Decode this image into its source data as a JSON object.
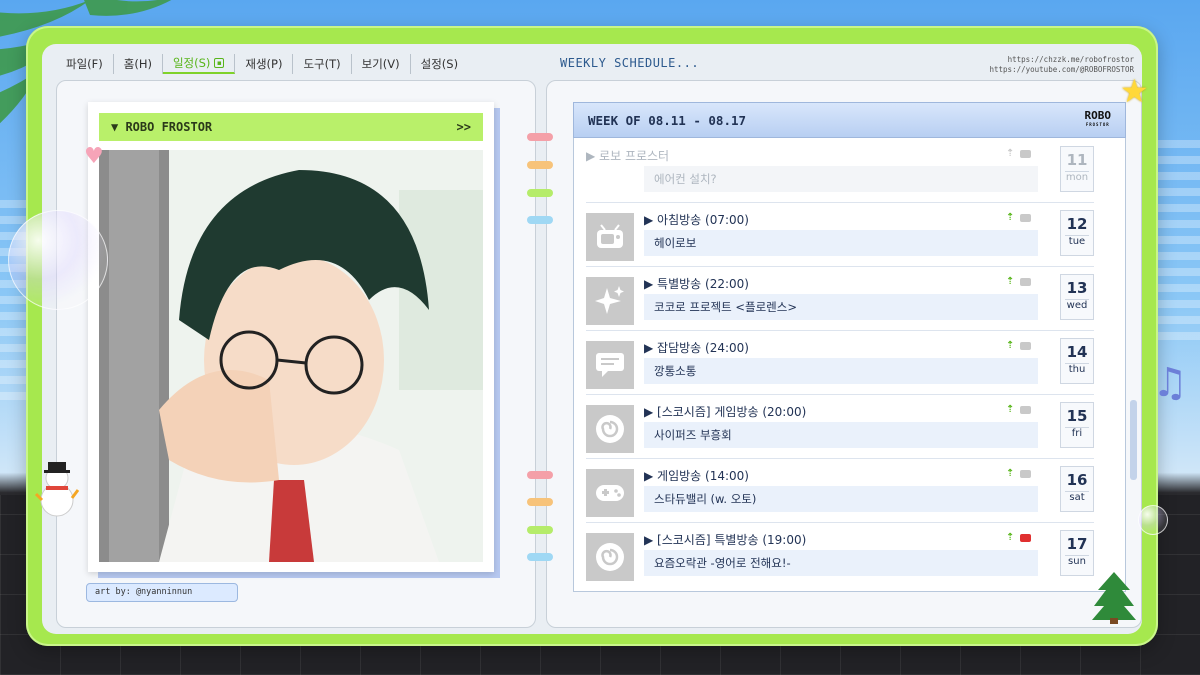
{
  "menu": {
    "items": [
      {
        "label": "파일(F)",
        "active": false
      },
      {
        "label": "홈(H)",
        "active": false
      },
      {
        "label": "일정(S)",
        "active": true
      },
      {
        "label": "재생(P)",
        "active": false
      },
      {
        "label": "도구(T)",
        "active": false
      },
      {
        "label": "보기(V)",
        "active": false
      },
      {
        "label": "설정(S)",
        "active": false
      }
    ]
  },
  "header": {
    "title": "WEEKLY SCHEDULE...",
    "link_chzzk": "https://chzzk.me/robofrostor",
    "link_youtube": "https://youtube.com/@ROBOFROSTOR"
  },
  "profile": {
    "name": "▼ ROBO FROSTOR",
    "arrow": ">>",
    "art_credit": "art by: @nyanninnun"
  },
  "schedule": {
    "week_label": "WEEK OF 08.11 - 08.17",
    "logo_main": "ROBO",
    "logo_sub": "FROSTOR",
    "days": [
      {
        "title": "▶ 로보 프로스터",
        "subtitle": "에어컨 설치?",
        "date": "11",
        "dow": "mon",
        "icon": "none",
        "faded": true,
        "youtube": false
      },
      {
        "title": "▶ 아침방송 (07:00)",
        "subtitle": "헤이로보",
        "date": "12",
        "dow": "tue",
        "icon": "tv-icon",
        "faded": false,
        "youtube": false
      },
      {
        "title": "▶ 특별방송 (22:00)",
        "subtitle": "코코로 프로젝트 <플로렌스>",
        "date": "13",
        "dow": "wed",
        "icon": "sparkle-icon",
        "faded": false,
        "youtube": false
      },
      {
        "title": "▶ 잡담방송 (24:00)",
        "subtitle": "깡통소통",
        "date": "14",
        "dow": "thu",
        "icon": "chat-icon",
        "faded": false,
        "youtube": false
      },
      {
        "title": "▶ [스코시즘] 게임방송 (20:00)",
        "subtitle": "사이퍼즈 부흥회",
        "date": "15",
        "dow": "fri",
        "icon": "swirl-icon",
        "faded": false,
        "youtube": false
      },
      {
        "title": "▶ 게임방송 (14:00)",
        "subtitle": "스타듀밸리 (w. 오토)",
        "date": "16",
        "dow": "sat",
        "icon": "gamepad-icon",
        "faded": false,
        "youtube": false
      },
      {
        "title": "▶ [스코시즘] 특별방송 (19:00)",
        "subtitle": "요즘오락관 -영어로 전해요!-",
        "date": "17",
        "dow": "sun",
        "icon": "swirl-icon",
        "faded": false,
        "youtube": true
      }
    ]
  },
  "colors": {
    "frame": "#a6e84e",
    "accent_green": "#58b51a",
    "header_blue": "#b8cff2",
    "text_navy": "#223355"
  }
}
